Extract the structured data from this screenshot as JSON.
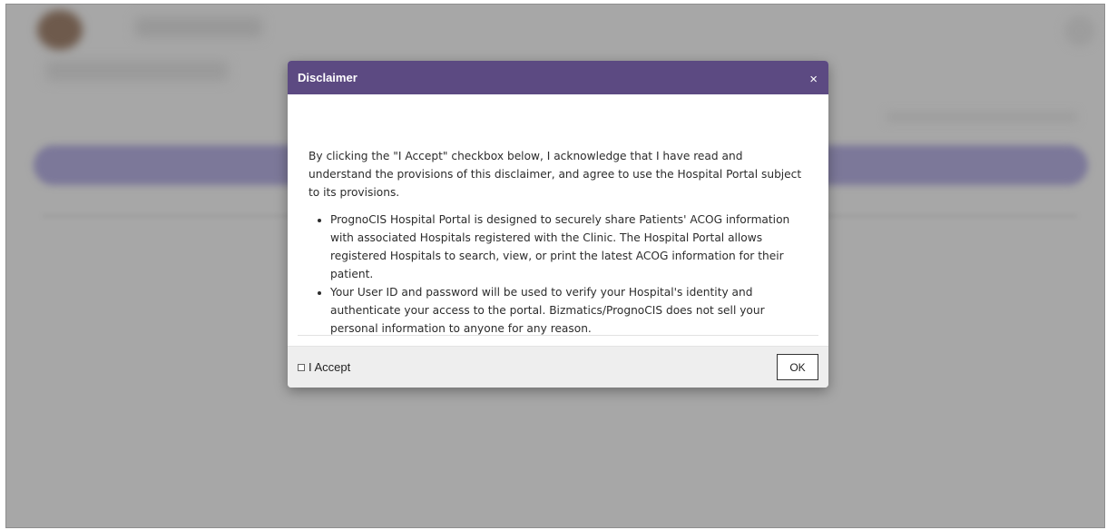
{
  "dialog": {
    "title": "Disclaimer",
    "close_glyph": "×",
    "intro": "By clicking the \"I Accept\" checkbox below, I acknowledge that I have read and understand the provisions of this disclaimer, and agree to use the Hospital Portal subject to its provisions.",
    "points": [
      "PrognoCIS Hospital Portal is designed to securely share Patients' ACOG information with associated Hospitals registered with the Clinic.  The Hospital Portal allows registered Hospitals to search, view, or print the latest ACOG information for their patient.",
      "Your User ID and password will be used to verify your Hospital's identity and authenticate your access to the portal. Bizmatics/PrognoCIS does not sell your personal information to anyone for any reason."
    ],
    "accept_label": "I Accept",
    "accept_checked": false,
    "ok_label": "OK"
  },
  "colors": {
    "header_bg": "#5c4a82",
    "overlay": "#a7a7a7",
    "footer_bg": "#eeeeee"
  }
}
